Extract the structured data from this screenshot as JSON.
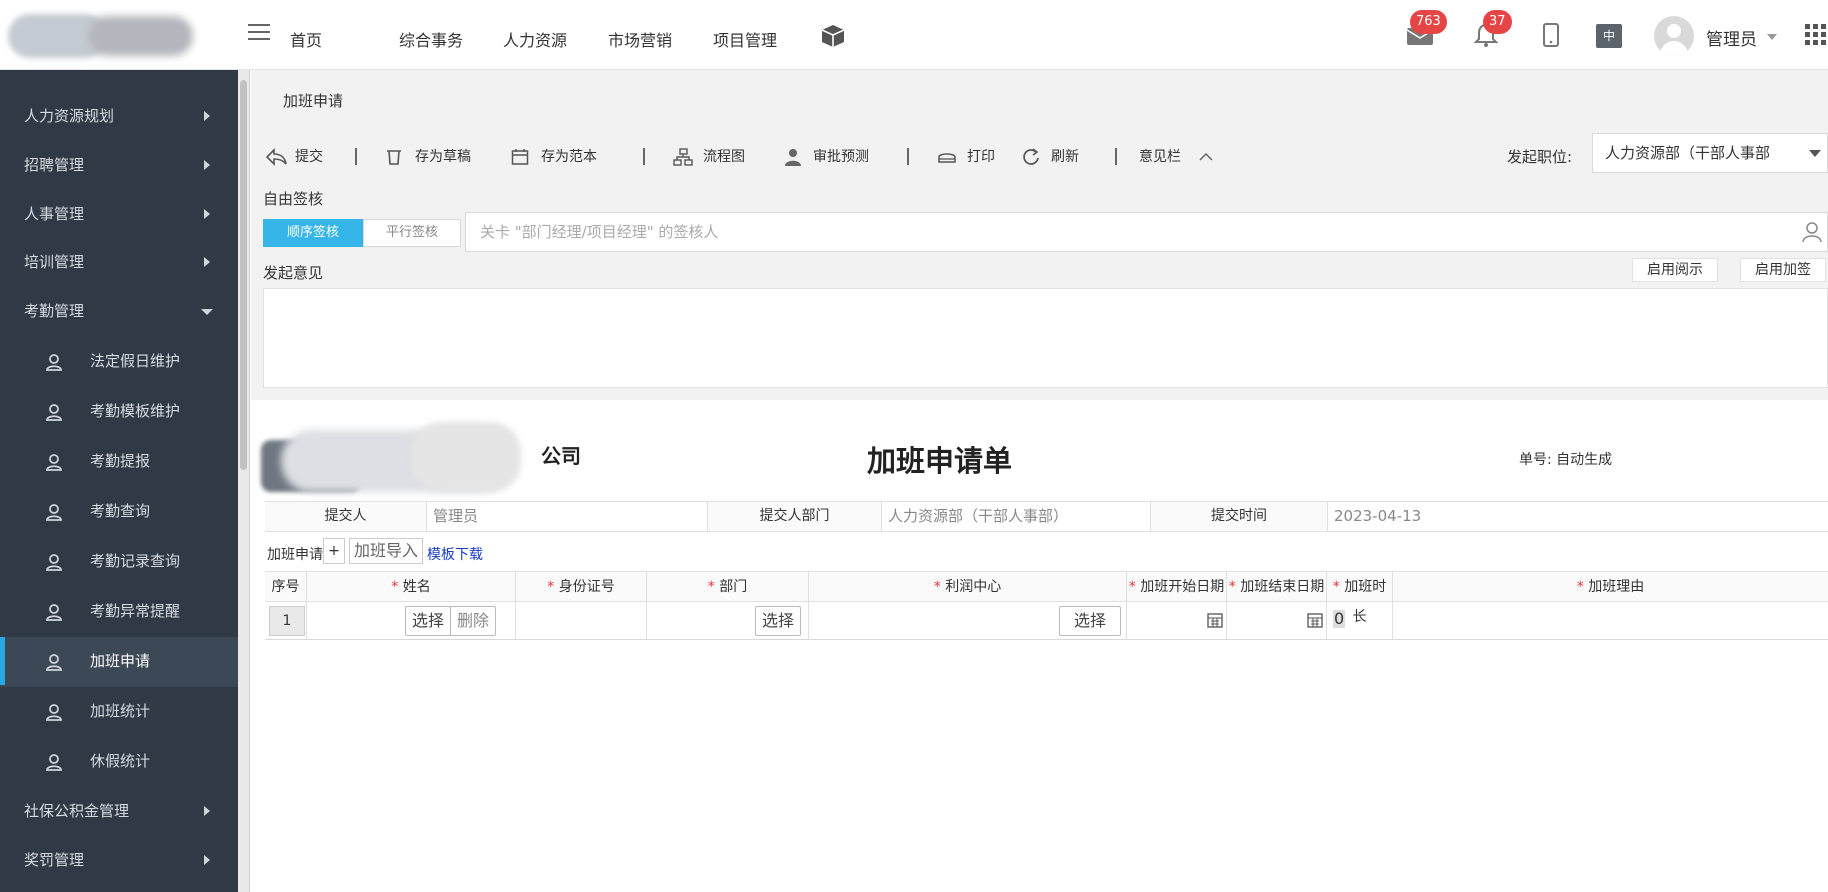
{
  "header": {
    "nav": [
      "首页",
      "综合事务",
      "人力资源",
      "市场营销",
      "项目管理"
    ],
    "mail_badge": "763",
    "bell_badge": "37",
    "lang": "中",
    "user": "管理员"
  },
  "sidebar": {
    "items": [
      {
        "label": "人力资源规划",
        "type": "group",
        "expanded": false
      },
      {
        "label": "招聘管理",
        "type": "group",
        "expanded": false
      },
      {
        "label": "人事管理",
        "type": "group",
        "expanded": false
      },
      {
        "label": "培训管理",
        "type": "group",
        "expanded": false
      },
      {
        "label": "考勤管理",
        "type": "group",
        "expanded": true
      },
      {
        "label": "法定假日维护",
        "type": "sub"
      },
      {
        "label": "考勤模板维护",
        "type": "sub"
      },
      {
        "label": "考勤提报",
        "type": "sub"
      },
      {
        "label": "考勤查询",
        "type": "sub"
      },
      {
        "label": "考勤记录查询",
        "type": "sub"
      },
      {
        "label": "考勤异常提醒",
        "type": "sub"
      },
      {
        "label": "加班申请",
        "type": "sub",
        "active": true
      },
      {
        "label": "加班统计",
        "type": "sub"
      },
      {
        "label": "休假统计",
        "type": "sub"
      },
      {
        "label": "社保公积金管理",
        "type": "group",
        "expanded": false
      },
      {
        "label": "奖罚管理",
        "type": "group",
        "expanded": false
      }
    ]
  },
  "page": {
    "title": "加班申请",
    "toolbar": {
      "submit": "提交",
      "save_draft": "存为草稿",
      "save_template": "存为范本",
      "flowchart": "流程图",
      "approval_predict": "审批预测",
      "print": "打印",
      "refresh": "刷新",
      "opinion_bar": "意见栏"
    },
    "position_label": "发起职位:",
    "position_value": "人力资源部（干部人事部",
    "free_sign_label": "自由签核",
    "seq_sign": "顺序签核",
    "par_sign": "平行签核",
    "signer_placeholder": "关卡 \"部门经理/项目经理\" 的签核人",
    "opinion_label": "发起意见",
    "enable_cc": "启用阅示",
    "enable_add": "启用加签"
  },
  "form": {
    "company_suffix": "公司",
    "title": "加班申请单",
    "number_label": "单号:",
    "number_value": "自动生成",
    "submitter_label": "提交人",
    "submitter_value": "管理员",
    "dept_label": "提交人部门",
    "dept_value": "人力资源部（干部人事部）",
    "time_label": "提交时间",
    "time_value": "2023-04-13",
    "sub_label": "加班申请",
    "add": "+",
    "import": "加班导入",
    "download": "模板下载",
    "columns": [
      "序号",
      "姓名",
      "身份证号",
      "部门",
      "利润中心",
      "加班开始日期",
      "加班结束日期",
      "加班时长",
      "加班理由"
    ],
    "required_mark": "*",
    "row": {
      "seq": "1",
      "select": "选择",
      "delete": "删除",
      "hours": "0"
    }
  },
  "colors": {
    "sidebar_bg": "#2f3a46",
    "accent": "#36b6e8",
    "badge": "#e64545"
  }
}
